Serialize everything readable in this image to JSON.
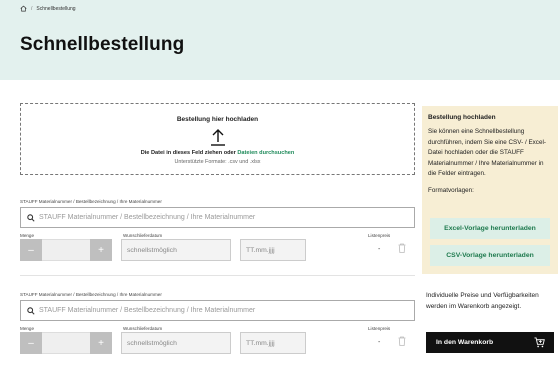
{
  "breadcrumb": {
    "current": "Schnellbestellung",
    "separator": "/"
  },
  "page": {
    "title": "Schnellbestellung"
  },
  "upload": {
    "title": "Bestellung hier hochladen",
    "instruction": "Die Datei in dieses Feld ziehen oder",
    "link": "Dateien durchsuchen",
    "formats": "Unterstützte Formate: .csv und .xlsx"
  },
  "info": {
    "title": "Bestellung hochladen",
    "text": "Sie können eine Schnellbestellung durchführen, indem Sie eine CSV- / Excel-Datei hochladen oder die STAUFF Materialnummer / Ihre Materialnummer in die Felder eintragen.",
    "formats_label": "Formatvorlagen:",
    "excel_button": "Excel-Vorlage herunterladen",
    "csv_button": "CSV-Vorlage herunterladen"
  },
  "rows": [
    {
      "label": "STAUFF Materialnummer / Bestellbezeichnung / Ihre Materialnummer",
      "placeholder": "STAUFF Materialnummer / Bestellbezeichnung / Ihre Materialnummer",
      "qty_label": "Menge",
      "date_label": "Wunschlieferdatum",
      "price_label": "Listenpreis",
      "date_option": "schnellstmöglich",
      "date_placeholder": "TT.mm.jjjj",
      "price": "-",
      "minus": "–",
      "plus": "+"
    },
    {
      "label": "STAUFF Materialnummer / Bestellbezeichnung / Ihre Materialnummer",
      "placeholder": "STAUFF Materialnummer / Bestellbezeichnung / Ihre Materialnummer",
      "qty_label": "Menge",
      "date_label": "Wunschlieferdatum",
      "price_label": "Listenpreis",
      "date_option": "schnellstmöglich",
      "date_placeholder": "TT.mm.jjjj",
      "price": "-",
      "minus": "–",
      "plus": "+"
    }
  ],
  "cart": {
    "note": "Individuelle Preise und Verfügbarkeiten werden im Warenkorb angezeigt.",
    "button": "In den Warenkorb"
  },
  "colors": {
    "hero": "#e3f1ee",
    "accent": "#1e8a5a",
    "info_bg": "#f7eed4",
    "template_btn": "#dcefe7"
  }
}
